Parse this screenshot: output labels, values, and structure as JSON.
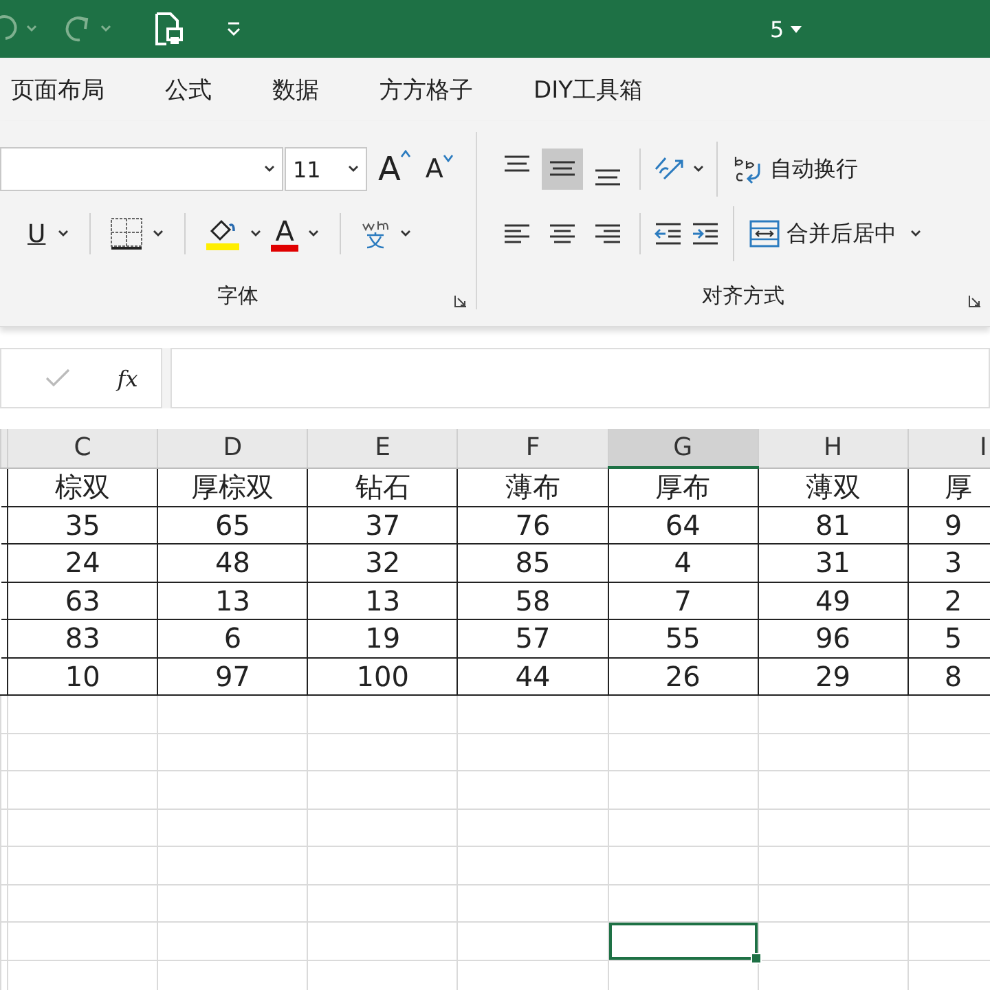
{
  "title_bar": {
    "text": "5"
  },
  "tabs": [
    {
      "label": "页面布局",
      "selected": false
    },
    {
      "label": "公式",
      "selected": false
    },
    {
      "label": "数据",
      "selected": false
    },
    {
      "label": "方方格子",
      "selected": false
    },
    {
      "label": "DIY工具箱",
      "selected": false
    }
  ],
  "font_group": {
    "font_size": "11",
    "grow_label": "A",
    "shrink_label": "A",
    "underline_label": "U",
    "font_color_label": "A",
    "label": "字体"
  },
  "align_group": {
    "vertical": [
      {
        "kind": "top",
        "selected": false
      },
      {
        "kind": "middle",
        "selected": true
      },
      {
        "kind": "bottom",
        "selected": false
      }
    ],
    "horizontal": [
      {
        "kind": "left",
        "selected": false
      },
      {
        "kind": "center",
        "selected": false
      },
      {
        "kind": "right",
        "selected": false
      }
    ],
    "wrap_label": "自动换行",
    "merge_label": "合并后居中",
    "label": "对齐方式"
  },
  "formula_bar": {
    "fx": "fx"
  },
  "sheet": {
    "columns": [
      {
        "letter": "C",
        "selected": false
      },
      {
        "letter": "D",
        "selected": false
      },
      {
        "letter": "E",
        "selected": false
      },
      {
        "letter": "F",
        "selected": false
      },
      {
        "letter": "G",
        "selected": true
      },
      {
        "letter": "H",
        "selected": false
      },
      {
        "letter": "I",
        "selected": false
      }
    ],
    "rows": [
      [
        "棕双",
        "厚棕双",
        "钻石",
        "薄布",
        "厚布",
        "薄双",
        "厚"
      ],
      [
        "35",
        "65",
        "37",
        "76",
        "64",
        "81",
        "9"
      ],
      [
        "24",
        "48",
        "32",
        "85",
        "4",
        "31",
        "3"
      ],
      [
        "63",
        "13",
        "13",
        "58",
        "7",
        "49",
        "2"
      ],
      [
        "83",
        "6",
        "19",
        "57",
        "55",
        "96",
        "5"
      ],
      [
        "10",
        "97",
        "100",
        "44",
        "26",
        "29",
        "8"
      ]
    ],
    "empty_rows": [
      {
        "active": false
      },
      {
        "active": false
      },
      {
        "active": false
      },
      {
        "active": false
      },
      {
        "active": false
      },
      {
        "active": false
      },
      {
        "active": true
      },
      {
        "active": false
      }
    ]
  }
}
